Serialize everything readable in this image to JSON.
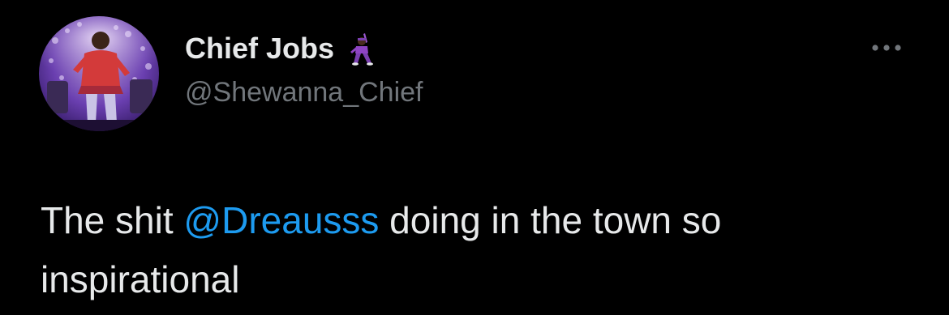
{
  "user": {
    "display_name": "Chief Jobs",
    "handle": "@Shewanna_Chief",
    "name_emoji": "man-dancing-icon"
  },
  "tweet": {
    "text_before": "The shit ",
    "mention": "@Dreausss",
    "text_after": " doing in the town so inspirational"
  },
  "toolbar": {
    "more_icon": "more-options-icon"
  },
  "colors": {
    "background": "#000000",
    "text_primary": "#e7e9ea",
    "text_secondary": "#71767b",
    "mention": "#1d9bf0"
  }
}
